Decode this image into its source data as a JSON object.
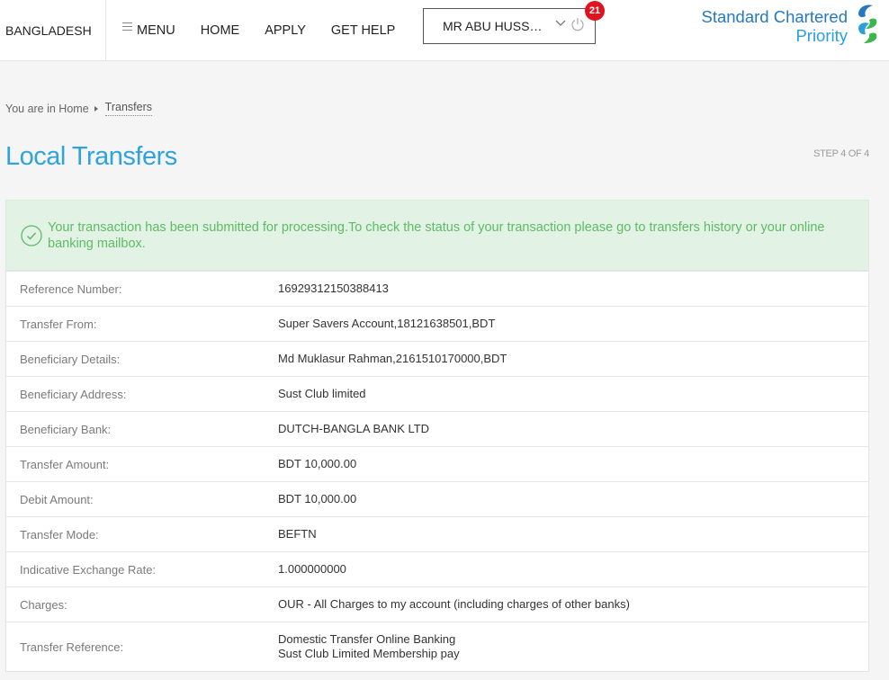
{
  "header": {
    "country": "BANGLADESH",
    "nav": [
      {
        "label": "MENU"
      },
      {
        "label": "HOME"
      },
      {
        "label": "APPLY"
      },
      {
        "label": "GET HELP"
      }
    ],
    "user_name": "MR ABU HUSSAIN",
    "notification_count": "21",
    "brand_line1": "Standard Chartered",
    "brand_line2": "Priority"
  },
  "breadcrumb": {
    "prefix": "You are in Home",
    "current": "Transfers"
  },
  "page": {
    "title": "Local Transfers",
    "step": "STEP 4 OF 4"
  },
  "success_message": "Your transaction has been submitted for processing.To check the status of your transaction please go to transfers history or your online banking mailbox.",
  "details": [
    {
      "label": "Reference Number:",
      "value": "16929312150388413"
    },
    {
      "label": "Transfer From:",
      "value": "Super Savers Account,18121638501,BDT"
    },
    {
      "label": "Beneficiary Details:",
      "value": "Md Muklasur Rahman,2161510170000,BDT"
    },
    {
      "label": "Beneficiary Address:",
      "value": "Sust Club limited"
    },
    {
      "label": "Beneficiary Bank:",
      "value": "DUTCH-BANGLA BANK LTD"
    },
    {
      "label": "Transfer Amount:",
      "value": "BDT 10,000.00"
    },
    {
      "label": "Debit Amount:",
      "value": "BDT 10,000.00"
    },
    {
      "label": "Transfer Mode:",
      "value": "BEFTN"
    },
    {
      "label": "Indicative Exchange Rate:",
      "value": "1.000000000"
    },
    {
      "label": "Charges:",
      "value": "OUR - All Charges to my account (including charges of other banks)"
    },
    {
      "label": "Transfer Reference:",
      "value": "Domestic Transfer Online Banking",
      "value2": "Sust Club Limited Membership pay"
    }
  ],
  "colors": {
    "accent": "#30a3dd",
    "success_bg": "#e2f3e5",
    "success_text": "#5dbb63",
    "badge": "#e0141e"
  },
  "icons": {
    "menu": "menu-icon",
    "chevron": "chevron-down-icon",
    "power": "power-icon",
    "check": "check-circle-icon",
    "logo": "standard-chartered-logo"
  }
}
